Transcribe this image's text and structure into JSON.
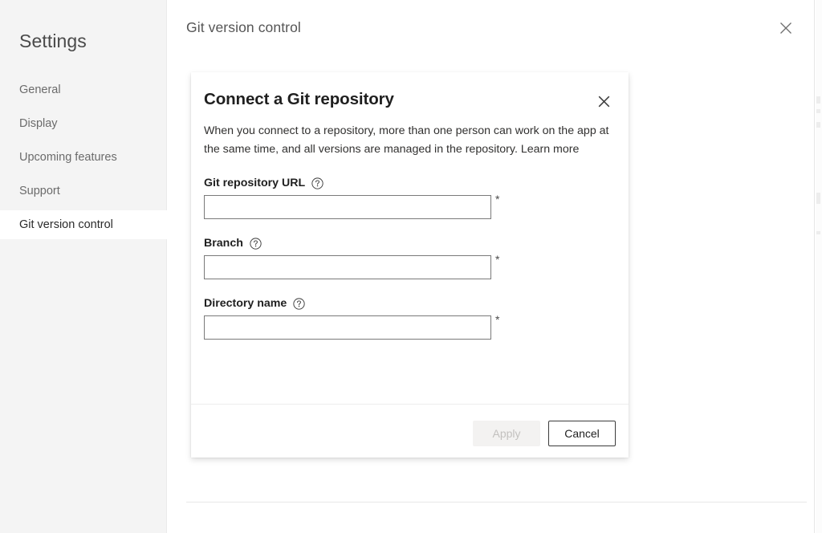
{
  "sidebar": {
    "title": "Settings",
    "items": [
      {
        "label": "General",
        "selected": false
      },
      {
        "label": "Display",
        "selected": false
      },
      {
        "label": "Upcoming features",
        "selected": false
      },
      {
        "label": "Support",
        "selected": false
      },
      {
        "label": "Git version control",
        "selected": true
      }
    ]
  },
  "main": {
    "title": "Git version control",
    "close_icon": "close-icon"
  },
  "dialog": {
    "title": "Connect a Git repository",
    "close_icon": "close-icon",
    "description": "When you connect to a repository, more than one person can work on the app at the same time, and all versions are managed in the repository. ",
    "learn_more": "Learn more",
    "required_marker": "*",
    "help_icon": "help-circle-icon",
    "fields": [
      {
        "label": "Git repository URL",
        "value": "",
        "placeholder": "",
        "required": true
      },
      {
        "label": "Branch",
        "value": "",
        "placeholder": "",
        "required": true
      },
      {
        "label": "Directory name",
        "value": "",
        "placeholder": "",
        "required": true
      }
    ],
    "apply_label": "Apply",
    "cancel_label": "Cancel"
  },
  "colors": {
    "sidebar_bg": "#f4f4f4",
    "page_bg": "#ffffff",
    "text_primary": "#1f1f1f",
    "text_secondary": "#6b6b6b",
    "input_border": "#7a7a7a",
    "apply_disabled_bg": "#f3f2f1",
    "apply_disabled_text": "#c3c1bf"
  }
}
